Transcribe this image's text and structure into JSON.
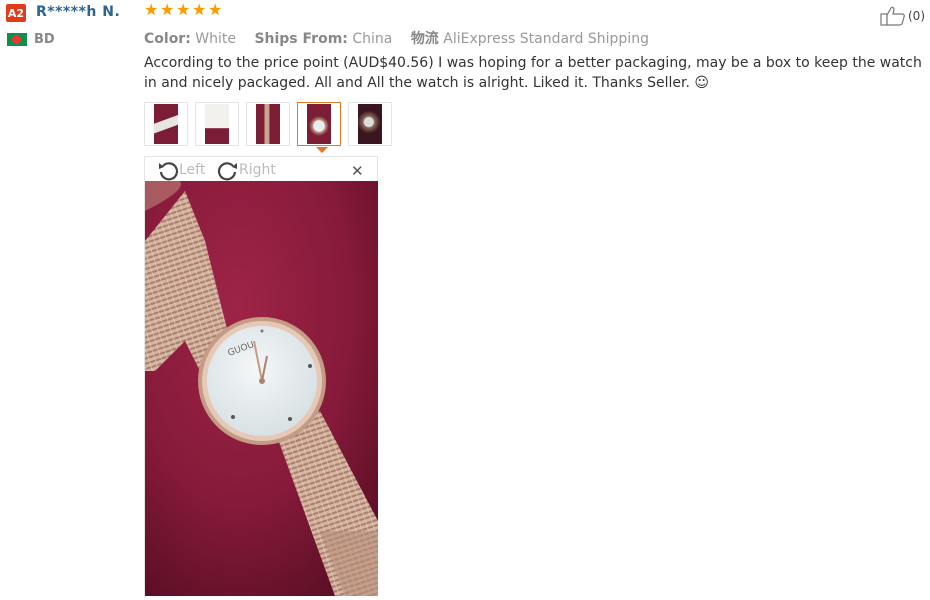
{
  "reviewer": {
    "badge": "A2",
    "name": "R*****h N.",
    "country": "BD"
  },
  "rating": {
    "stars": 5,
    "max": 5
  },
  "like": {
    "count": "(0)"
  },
  "meta": {
    "color_label": "Color:",
    "color_value": "White",
    "ships_label": "Ships From:",
    "ships_value": "China",
    "logistics_label": "物流",
    "logistics_value": "AliExpress Standard Shipping"
  },
  "review_text": "According to the price point (AUD$40.56) I was hoping for a better packaging, may be a box to keep the watch in and nicely packaged. All and All the watch is alright. Liked it. Thanks Seller. ☺",
  "thumbnails": {
    "count": 5,
    "selected_index": 3
  },
  "viewer": {
    "rotate_left": "Left",
    "rotate_right": "Right",
    "close_icon": "close-icon",
    "watch_brand": "GUOU"
  },
  "colors": {
    "badge": "#e03c1c",
    "name": "#2a6496",
    "stars": "#ff9900",
    "selected_thumb": "#e87722",
    "flag_green": "#0f8f4a",
    "flag_red": "#e53935",
    "photo_bg": "#8a1a3a"
  }
}
